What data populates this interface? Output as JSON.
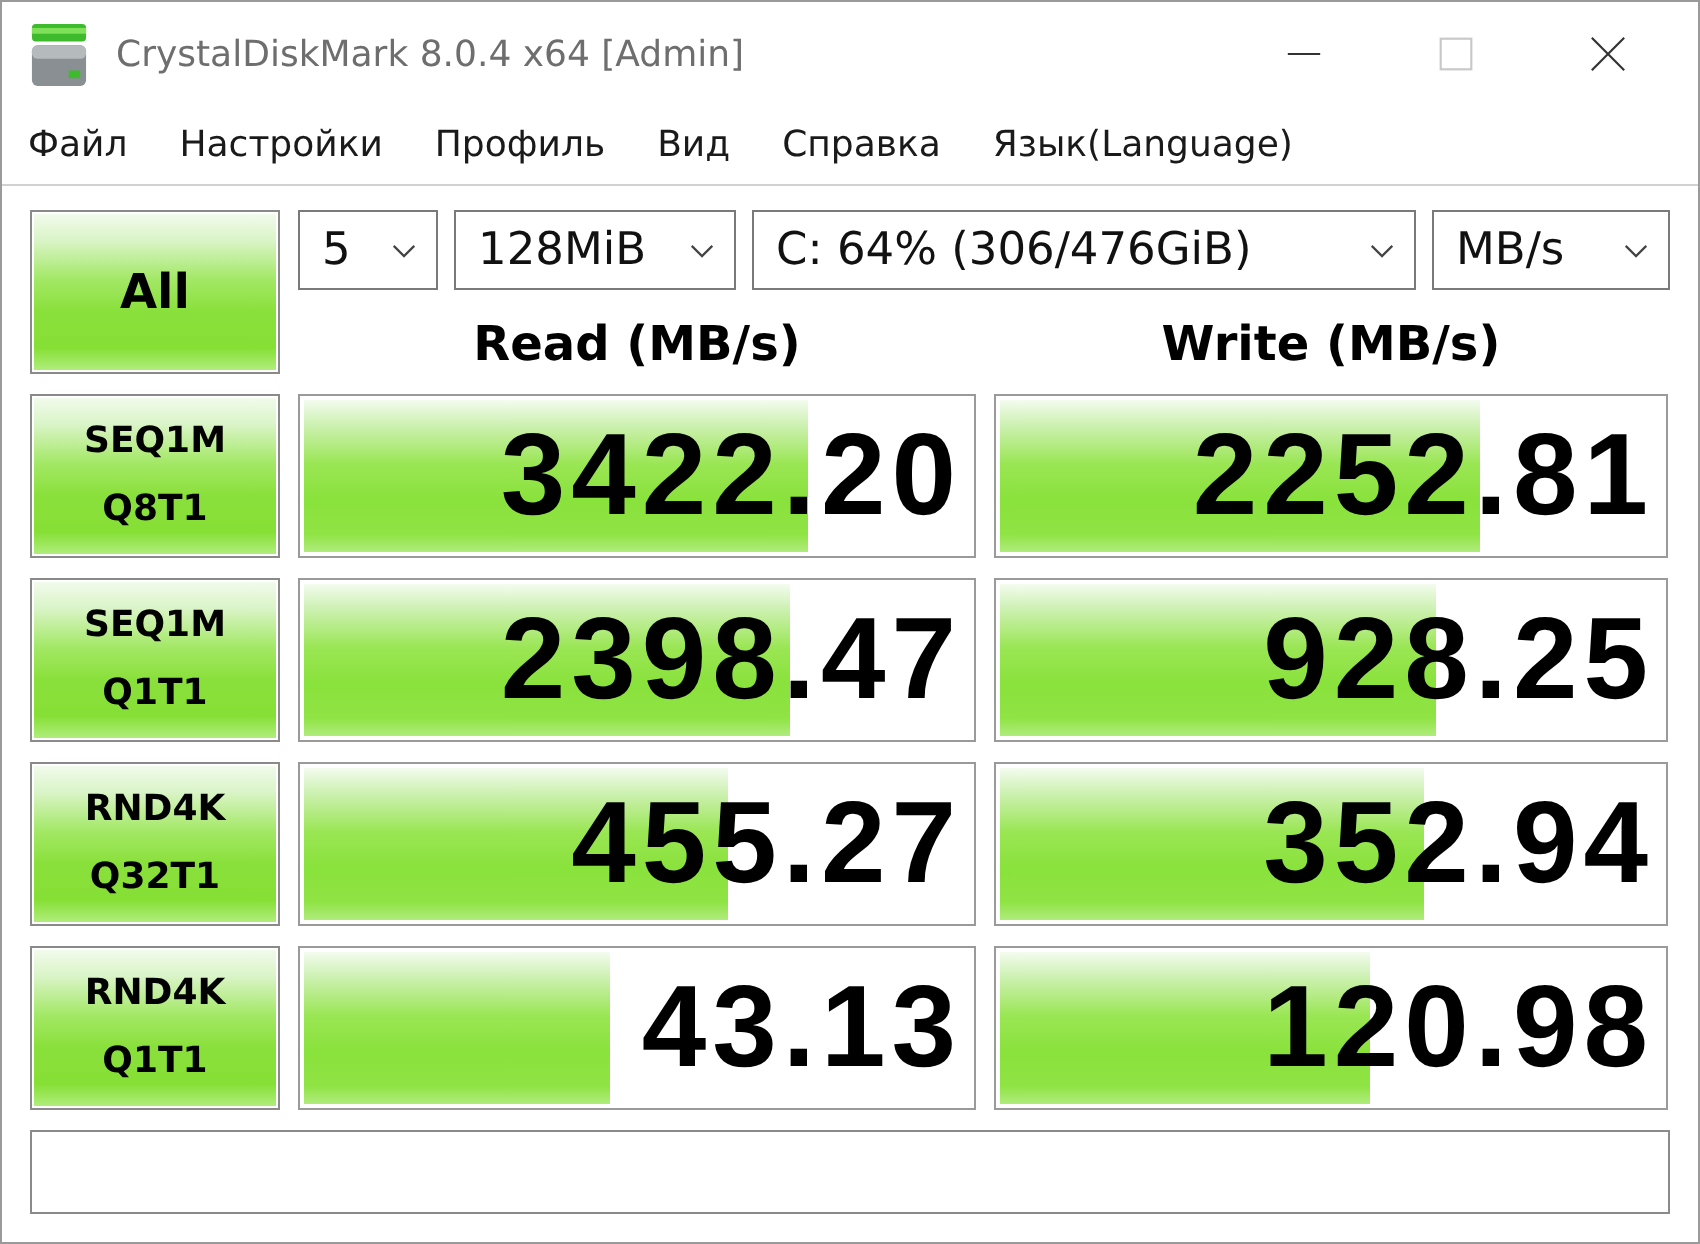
{
  "window": {
    "title": "CrystalDiskMark 8.0.4 x64 [Admin]",
    "controls": [
      {
        "kind": "minimize",
        "disabled": false
      },
      {
        "kind": "maximize",
        "disabled": true
      },
      {
        "kind": "close",
        "disabled": false
      }
    ]
  },
  "menu": [
    "Файл",
    "Настройки",
    "Профиль",
    "Вид",
    "Справка",
    "Язык(Language)"
  ],
  "toolbar": {
    "all_button": "All",
    "dropdowns": [
      {
        "value": "5"
      },
      {
        "value": "128MiB"
      },
      {
        "value": "C: 64% (306/476GiB)"
      },
      {
        "value": "MB/s"
      }
    ]
  },
  "columns": [
    "Read (MB/s)",
    "Write (MB/s)"
  ],
  "rows": [
    {
      "test": "SEQ1M",
      "params": "Q8T1",
      "read": {
        "value": "3422.20",
        "level": 0.757
      },
      "write": {
        "value": "2252.81",
        "level": 0.724
      }
    },
    {
      "test": "SEQ1M",
      "params": "Q1T1",
      "read": {
        "value": "2398.47",
        "level": 0.73
      },
      "write": {
        "value": "928.25",
        "level": 0.66
      }
    },
    {
      "test": "RND4K",
      "params": "Q32T1",
      "read": {
        "value": "455.27",
        "level": 0.636
      },
      "write": {
        "value": "352.94",
        "level": 0.64
      }
    },
    {
      "test": "RND4K",
      "params": "Q1T1",
      "read": {
        "value": "43.13",
        "level": 0.46
      },
      "write": {
        "value": "120.98",
        "level": 0.56
      }
    }
  ]
}
